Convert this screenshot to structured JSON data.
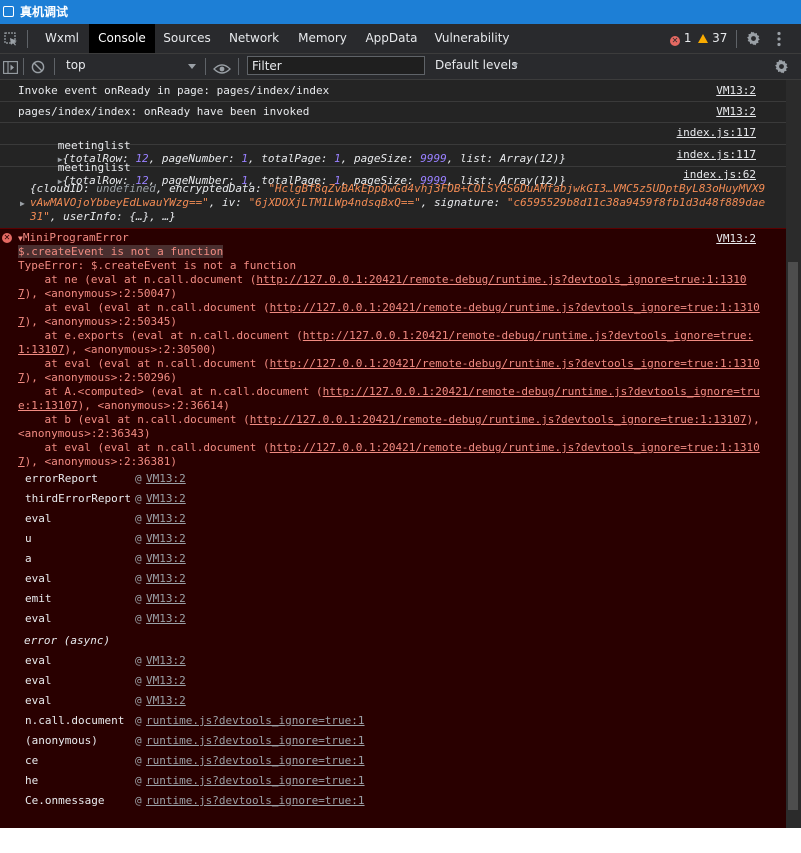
{
  "window": {
    "title": "真机调试"
  },
  "tabs": [
    {
      "label": "Wxml"
    },
    {
      "label": "Console"
    },
    {
      "label": "Sources"
    },
    {
      "label": "Network"
    },
    {
      "label": "Memory"
    },
    {
      "label": "AppData"
    },
    {
      "label": "Vulnerability"
    }
  ],
  "status": {
    "errors": "1",
    "warnings": "37"
  },
  "toolbar": {
    "context": "top",
    "filter_placeholder": "Filter",
    "levels": "Default levels"
  },
  "console": {
    "messages": [
      {
        "text": "Invoke event onReady in page: pages/index/index",
        "source": "VM13:2"
      },
      {
        "text": "pages/index/index: onReady have been invoked",
        "source": "VM13:2"
      }
    ],
    "meeting": [
      {
        "label": "meetinglist",
        "source": "index.js:117"
      },
      {
        "label": "meetinglist",
        "source": "index.js:117"
      }
    ],
    "meeting_obj": {
      "open": "{",
      "k_totalRow": "totalRow: ",
      "v_totalRow": "12",
      "k_pageNumber": ", pageNumber: ",
      "v_pageNumber": "1",
      "k_totalPage": ", totalPage: ",
      "v_totalPage": "1",
      "k_pageSize": ", pageSize: ",
      "v_pageSize": "9999",
      "k_list": ", list: ",
      "v_list": "Array(12)",
      "close": "}"
    },
    "cloud": {
      "source": "index.js:62",
      "line1_a": "{cloudID: ",
      "line1_b": "undefined",
      "line1_c": ", encryptedData: ",
      "line1_d": "\"HclgBf8qZvBAkEppQwGd4vhj3FOB+COLSYGS6DuAMfabjwkGI3…VMC5z5UDptByL83oHuyMVX9",
      "line2_a": "vAwMAVOjoYbbeyEdLwauYWzg==\"",
      "line2_b": ", iv: ",
      "line2_c": "\"6jXDOXjLTM1LWp4ndsqBxQ==\"",
      "line2_d": ", signature: ",
      "line2_e": "\"c6595529b8d11c38a9459f8fb1d3d48f889dae",
      "line3_a": "31\"",
      "line3_b": ", userInfo: {…}, …}"
    },
    "error": {
      "title": "MiniProgramError",
      "source": "VM13:2",
      "message": "$.createEvent is not a function",
      "type_line": "TypeError: $.createEvent is not a function",
      "stack": [
        {
          "pre": "    at ne (eval at n.call.document (",
          "link": "http://127.0.0.1:20421/remote-debug/runtime.js?devtools_ignore=true:1:1310"
        },
        {
          "pre": "",
          "link": "7",
          "post": "), <anonymous>:2:50047)"
        },
        {
          "pre": "    at eval (eval at n.call.document (",
          "link": "http://127.0.0.1:20421/remote-debug/runtime.js?devtools_ignore=true:1:1310"
        },
        {
          "pre": "",
          "link": "7",
          "post": "), <anonymous>:2:50345)"
        },
        {
          "pre": "    at e.exports (eval at n.call.document (",
          "link": "http://127.0.0.1:20421/remote-debug/runtime.js?devtools_ignore=true:"
        },
        {
          "pre": "",
          "link": "1:13107",
          "post": "), <anonymous>:2:30500)"
        },
        {
          "pre": "    at eval (eval at n.call.document (",
          "link": "http://127.0.0.1:20421/remote-debug/runtime.js?devtools_ignore=true:1:1310"
        },
        {
          "pre": "",
          "link": "7",
          "post": "), <anonymous>:2:50296)"
        },
        {
          "pre": "    at A.<computed> (eval at n.call.document (",
          "link": "http://127.0.0.1:20421/remote-debug/runtime.js?devtools_ignore=tru"
        },
        {
          "pre": "",
          "link": "e:1:13107",
          "post": "), <anonymous>:2:36614)"
        },
        {
          "pre": "    at b (eval at n.call.document (",
          "link": "http://127.0.0.1:20421/remote-debug/runtime.js?devtools_ignore=true:1:13107",
          "post": "),"
        },
        {
          "pre": "<anonymous>:2:36343)",
          "link": ""
        },
        {
          "pre": "    at eval (eval at n.call.document (",
          "link": "http://127.0.0.1:20421/remote-debug/runtime.js?devtools_ignore=true:1:1310"
        },
        {
          "pre": "",
          "link": "7",
          "post": "), <anonymous>:2:36381)"
        }
      ],
      "frames": [
        {
          "fn": "errorReport",
          "src": "VM13:2"
        },
        {
          "fn": "thirdErrorReport",
          "src": "VM13:2"
        },
        {
          "fn": "eval",
          "src": "VM13:2"
        },
        {
          "fn": "u",
          "src": "VM13:2"
        },
        {
          "fn": "a",
          "src": "VM13:2"
        },
        {
          "fn": "eval",
          "src": "VM13:2"
        },
        {
          "fn": "emit",
          "src": "VM13:2"
        },
        {
          "fn": "eval",
          "src": "VM13:2"
        }
      ],
      "async_label": "error (async)",
      "frames2": [
        {
          "fn": "eval",
          "src": "VM13:2"
        },
        {
          "fn": "eval",
          "src": "VM13:2"
        },
        {
          "fn": "eval",
          "src": "VM13:2"
        },
        {
          "fn": "n.call.document",
          "src": "runtime.js?devtools_ignore=true:1"
        },
        {
          "fn": "(anonymous)",
          "src": "runtime.js?devtools_ignore=true:1"
        },
        {
          "fn": "ce",
          "src": "runtime.js?devtools_ignore=true:1"
        },
        {
          "fn": "he",
          "src": "runtime.js?devtools_ignore=true:1"
        },
        {
          "fn": "Ce.onmessage",
          "src": "runtime.js?devtools_ignore=true:1"
        }
      ],
      "at_sign": "@"
    }
  }
}
